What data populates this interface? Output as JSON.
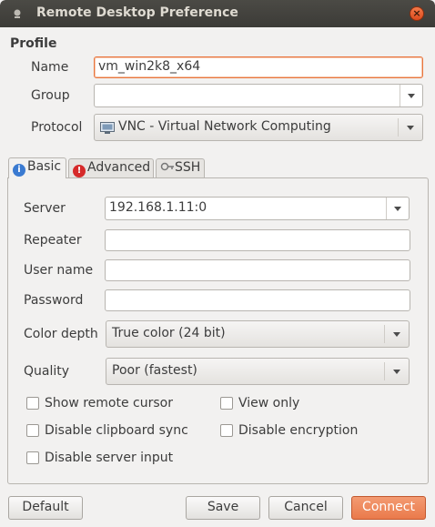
{
  "window": {
    "title": "Remote Desktop Preference",
    "close_symbol": "×"
  },
  "profile": {
    "heading": "Profile",
    "name_label": "Name",
    "name_value": "vm_win2k8_x64",
    "group_label": "Group",
    "group_value": "",
    "protocol_label": "Protocol",
    "protocol_value": "VNC - Virtual Network Computing"
  },
  "tabs": [
    {
      "label": "Basic",
      "icon": "info-icon",
      "icon_color": "#3a7ad1",
      "active": true
    },
    {
      "label": "Advanced",
      "icon": "warning-icon",
      "icon_color": "#d62a2a",
      "active": false
    },
    {
      "label": "SSH",
      "icon": "key-icon",
      "active": false
    }
  ],
  "basic": {
    "server_label": "Server",
    "server_value": "192.168.1.11:0",
    "repeater_label": "Repeater",
    "repeater_value": "",
    "username_label": "User name",
    "username_value": "",
    "password_label": "Password",
    "password_value": "",
    "color_depth_label": "Color depth",
    "color_depth_value": "True color (24 bit)",
    "quality_label": "Quality",
    "quality_value": "Poor (fastest)",
    "checkboxes": {
      "show_remote_cursor": {
        "label": "Show remote cursor",
        "checked": false
      },
      "view_only": {
        "label": "View only",
        "checked": false
      },
      "disable_clipboard_sync": {
        "label": "Disable clipboard sync",
        "checked": false
      },
      "disable_encryption": {
        "label": "Disable encryption",
        "checked": false
      },
      "disable_server_input": {
        "label": "Disable server input",
        "checked": false
      }
    }
  },
  "buttons": {
    "default": "Default",
    "save": "Save",
    "cancel": "Cancel",
    "connect": "Connect"
  },
  "colors": {
    "accent": "#e9763f",
    "titlebar": "#3c3b37",
    "connect": "#ea7a4b"
  }
}
